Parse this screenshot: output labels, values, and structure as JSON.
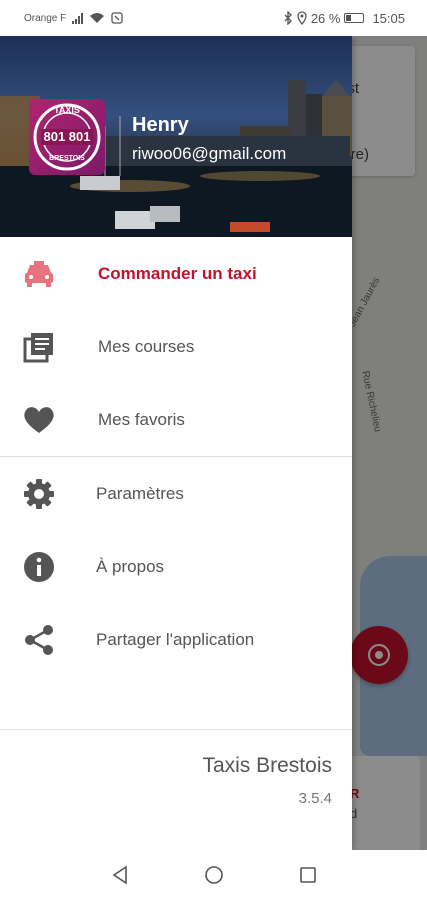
{
  "status_bar": {
    "carrier": "Orange F",
    "battery": "26 %",
    "time": "15:05"
  },
  "map": {
    "card_line1": "est",
    "card_line2": "pire)",
    "street_a": "Rue Jean Jaurès",
    "street_b": "Rue Richelieu",
    "bottom_card_line1": "R",
    "bottom_card_line2": "d"
  },
  "drawer": {
    "header": {
      "logo_text_top": "TAXIS",
      "logo_number": "801 801",
      "logo_text_bottom": "BRESTOIS",
      "user_name": "Henry",
      "user_email": "riwoo06@gmail.com"
    },
    "menu": [
      {
        "label": "Commander un taxi",
        "icon": "taxi-icon",
        "active": true
      },
      {
        "label": "Mes courses",
        "icon": "list-icon",
        "active": false
      },
      {
        "label": "Mes favoris",
        "icon": "heart-icon",
        "active": false
      },
      {
        "label": "Paramètres",
        "icon": "gear-icon",
        "active": false
      },
      {
        "label": "À propos",
        "icon": "info-icon",
        "active": false
      },
      {
        "label": "Partager l'application",
        "icon": "share-icon",
        "active": false
      }
    ],
    "footer": {
      "brand": "Taxis Brestois",
      "version": "3.5.4"
    }
  },
  "colors": {
    "accent": "#c4122d",
    "active_icon": "#e8737f",
    "icon": "#555555"
  }
}
